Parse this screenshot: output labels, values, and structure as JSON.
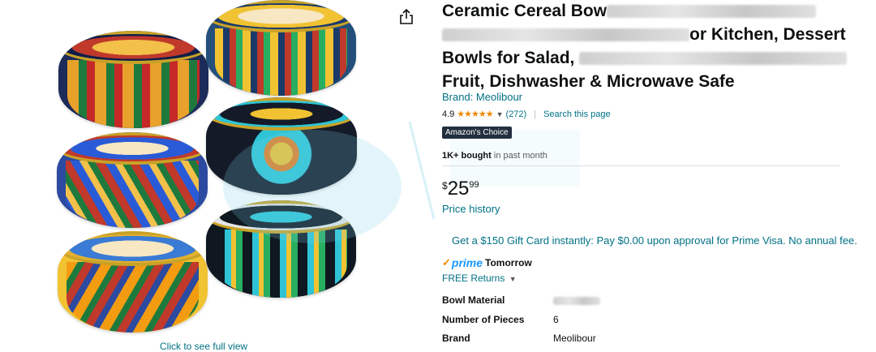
{
  "gallery": {
    "see_full_view": "Click to see full view"
  },
  "product": {
    "title_part1": "Ceramic Cereal Bow",
    "title_part2": "or Kitchen, Dessert",
    "title_part3": "Bowls for Salad,",
    "title_part4": "Fruit, Dishwasher & Microwave Safe",
    "brand_link": "Brand: Meolibour",
    "rating": "4.9",
    "stars": "★★★★★",
    "rating_count": "(272)",
    "search_page": "Search this page",
    "badge": "Amazon's Choice",
    "bought_bold": "1K+ bought",
    "bought_rest": " in past month",
    "price_currency": "$",
    "price_whole": "25",
    "price_fraction": "99",
    "price_history": "Price history",
    "gift_offer": "Get a $150 Gift Card instantly: Pay $0.00 upon approval for Prime Visa. No annual fee.",
    "prime_word": "prime",
    "delivery": "Tomorrow",
    "returns": "FREE Returns",
    "specs": [
      {
        "key": "Bowl Material",
        "value": ""
      },
      {
        "key": "Number of Pieces",
        "value": "6"
      },
      {
        "key": "Brand",
        "value": "Meolibour"
      }
    ]
  },
  "colors": {
    "link": "#007185",
    "star": "#f08804",
    "prime": "#1a98ff",
    "badge_bg": "#232f3e"
  }
}
